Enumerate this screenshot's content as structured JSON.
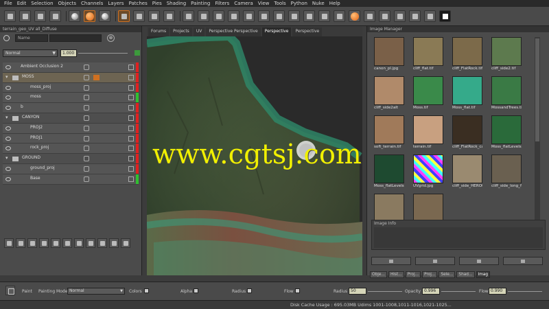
{
  "menu": [
    "File",
    "Edit",
    "Selection",
    "Objects",
    "Channels",
    "Layers",
    "Patches",
    "Pies",
    "Shading",
    "Painting",
    "Filters",
    "Camera",
    "View",
    "Tools",
    "Python",
    "Nuke",
    "Help"
  ],
  "layers_panel": {
    "title": "terrain_geo_UV all_Diffuse",
    "search_filter": "Name",
    "blend_mode": "Normal",
    "opacity": "1.000",
    "layers": [
      {
        "label": "Ambient Occlusion 2",
        "type": "layer",
        "indent": 1,
        "selected": false,
        "color": "#e02020"
      },
      {
        "label": "MOSS",
        "type": "group",
        "indent": 0,
        "selected": true,
        "color": "#e02020"
      },
      {
        "label": "moss_proj",
        "type": "layer",
        "indent": 2,
        "selected": false,
        "color": "#e02020"
      },
      {
        "label": "moss",
        "type": "layer",
        "indent": 2,
        "selected": false,
        "color": "#30c030"
      },
      {
        "label": "b",
        "type": "layer",
        "indent": 1,
        "selected": false,
        "color": "#e02020"
      },
      {
        "label": "CANYON",
        "type": "group",
        "indent": 0,
        "selected": false,
        "color": "#e02020"
      },
      {
        "label": "PROJ2",
        "type": "layer",
        "indent": 2,
        "selected": false,
        "color": "#e02020"
      },
      {
        "label": "PROJ1",
        "type": "layer",
        "indent": 2,
        "selected": false,
        "color": "#e02020"
      },
      {
        "label": "rock_proj",
        "type": "layer",
        "indent": 2,
        "selected": false,
        "color": "#e02020"
      },
      {
        "label": "GROUND",
        "type": "group",
        "indent": 0,
        "selected": false,
        "color": "#e02020"
      },
      {
        "label": "ground_proj",
        "type": "layer",
        "indent": 2,
        "selected": false,
        "color": "#e02020"
      },
      {
        "label": "Base",
        "type": "layer",
        "indent": 2,
        "selected": false,
        "color": "#30c030"
      }
    ]
  },
  "viewport": {
    "tabs": [
      "Forums",
      "Projects",
      "UV",
      "Perspective Perspective",
      "Perspective",
      "Perspective"
    ],
    "active_tab": 4,
    "watermark": "www.cgtsj.com"
  },
  "image_manager": {
    "title": "Image Manager",
    "images": [
      {
        "label": "canon_pl.jpg",
        "color": "#7a6048"
      },
      {
        "label": "cliff_flat.tif",
        "color": "#8a7a55"
      },
      {
        "label": "cliff_FlatRock.tif",
        "color": "#7c6a4a"
      },
      {
        "label": "cliff_side2.tif",
        "color": "#5d7a4e"
      },
      {
        "label": "cliff_side2alt",
        "color": "#b08a6a"
      },
      {
        "label": "Moss.tif",
        "color": "#3a8a4a"
      },
      {
        "label": "Moss_flat.tif",
        "color": "#35aa8a"
      },
      {
        "label": "MossandTrees.tif",
        "color": "#3a7a45"
      },
      {
        "label": "soft_terrain.tif",
        "color": "#a07a5a"
      },
      {
        "label": "terrain.tif",
        "color": "#c8a080"
      },
      {
        "label": "cliff_FlatRock_cav",
        "color": "#3a2e22"
      },
      {
        "label": "Moss_flatLevels7",
        "color": "#2a6a3a"
      },
      {
        "label": "Moss_flatLevels08",
        "color": "#1e4a30"
      },
      {
        "label": "UVgrid.jpg",
        "color": "#ff40ff"
      },
      {
        "label": "cliff_side_HEROt",
        "color": "#9a8a70"
      },
      {
        "label": "cliff_side_long_f",
        "color": "#6a6050"
      },
      {
        "label": "cliff_side_HEROt",
        "color": "#8a7a60"
      },
      {
        "label": "cliff_side_long_H",
        "color": "#7a6850"
      }
    ],
    "info_header": "Image Info",
    "bottom_tabs": [
      "Obje...",
      "Hist...",
      "Proj...",
      "Proj...",
      "Sele...",
      "Shad...",
      "Imag"
    ],
    "active_bottom_tab": 6
  },
  "paint_bar": {
    "paint_label": "Paint",
    "mode_label": "Painting Mode",
    "mode_value": "Normal",
    "colors_label": "Colors",
    "alpha_label": "Alpha",
    "radius_label": "Radius",
    "flow_label": "Flow",
    "radius2_label": "Radius",
    "radius_value": "50",
    "opacity_label": "Opacity",
    "opacity_value": "0.996",
    "flow2_label": "Flow",
    "flow_value": "0.990"
  },
  "status": {
    "text": "Disk Cache Usage : 695.03MB   Udims 1001-1008,1011-1016,1021-1025..."
  }
}
